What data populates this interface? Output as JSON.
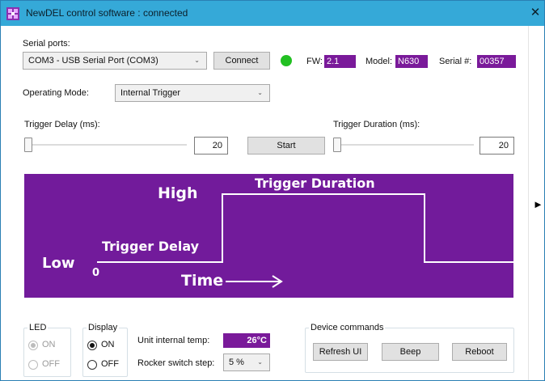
{
  "window": {
    "title": "NewDEL control software : connected",
    "close_glyph": "✕",
    "side_arrow": "►"
  },
  "serial": {
    "label": "Serial ports:",
    "selected_port": "COM3 - USB Serial Port (COM3)",
    "connect_label": "Connect",
    "status_color": "#22c022",
    "fw_label": "FW:",
    "fw_value": "2.1",
    "model_label": "Model:",
    "model_value": "N630",
    "serial_label": "Serial #:",
    "serial_value": "00357"
  },
  "mode": {
    "label": "Operating Mode:",
    "selected": "Internal Trigger"
  },
  "trigger": {
    "delay_label": "Trigger Delay (ms):",
    "delay_value": "20",
    "duration_label": "Trigger Duration (ms):",
    "duration_value": "20",
    "start_label": "Start",
    "delay_slider_fraction": 0,
    "duration_slider_fraction": 0
  },
  "diagram": {
    "high": "High",
    "low": "Low",
    "zero": "0",
    "trigger_delay": "Trigger Delay",
    "trigger_duration": "Trigger Duration",
    "time": "Time"
  },
  "led": {
    "title": "LED",
    "on": "ON",
    "off": "OFF",
    "state": "ON",
    "enabled": false
  },
  "display": {
    "title": "Display",
    "on": "ON",
    "off": "OFF",
    "state": "ON"
  },
  "unit": {
    "temp_label": "Unit internal temp:",
    "temp_value": "26°C",
    "rocker_label": "Rocker switch step:",
    "rocker_value": "5 %"
  },
  "commands": {
    "title": "Device commands",
    "refresh": "Refresh UI",
    "beep": "Beep",
    "reboot": "Reboot"
  },
  "colors": {
    "accent_purple": "#721b9b",
    "titlebar": "#35a9d8"
  }
}
